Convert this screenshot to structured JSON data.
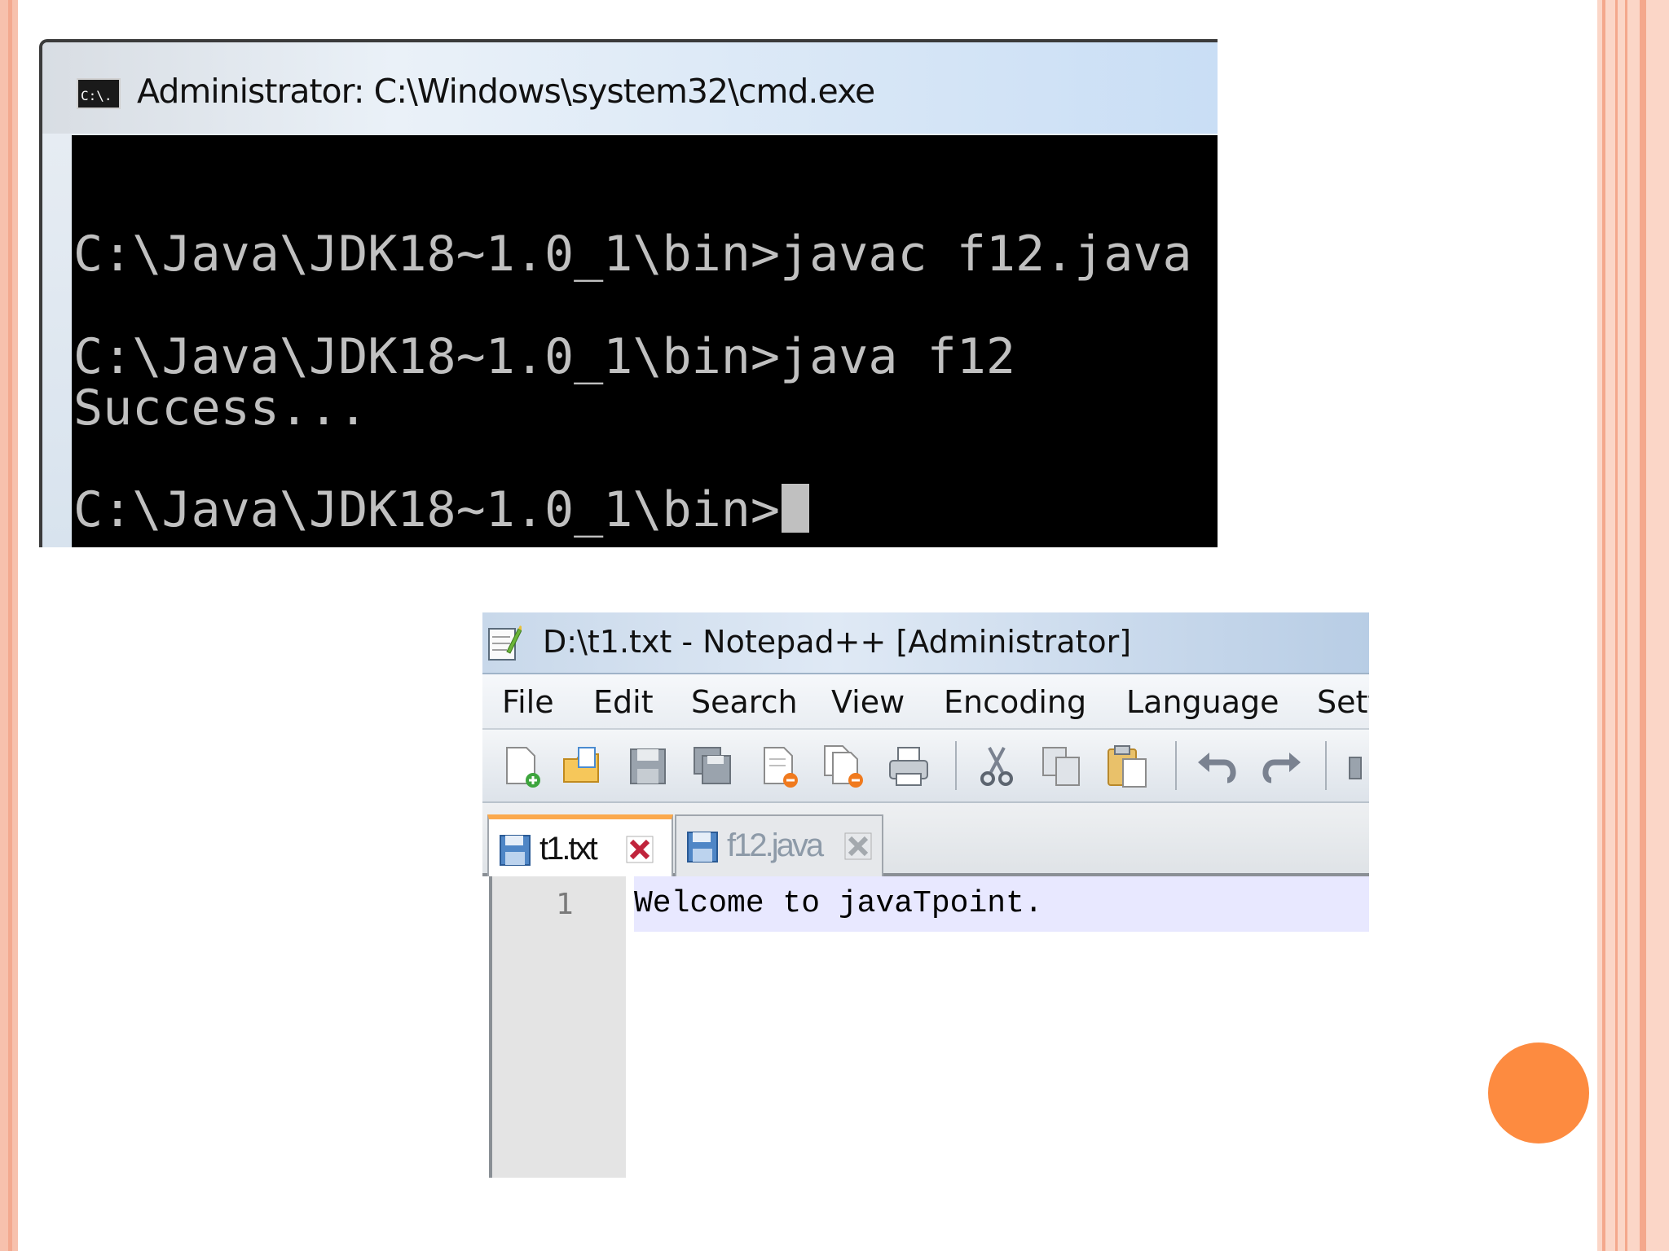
{
  "cmd": {
    "title": "Administrator: C:\\Windows\\system32\\cmd.exe",
    "icon_text": "C:\\.",
    "lines": [
      "C:\\Java\\JDK18~1.0_1\\bin>javac f12.java",
      "C:\\Java\\JDK18~1.0_1\\bin>java f12",
      "Success...",
      "C:\\Java\\JDK18~1.0_1\\bin>"
    ]
  },
  "notepad": {
    "title": "D:\\t1.txt - Notepad++ [Administrator]",
    "menu": [
      "File",
      "Edit",
      "Search",
      "View",
      "Encoding",
      "Language",
      "Sett"
    ],
    "toolbar_icons": [
      "new-file-icon",
      "open-file-icon",
      "save-icon",
      "save-all-icon",
      "close-icon",
      "close-all-icon",
      "print-icon",
      "cut-icon",
      "copy-icon",
      "paste-icon",
      "undo-icon",
      "redo-icon"
    ],
    "tabs": [
      {
        "label": "t1.txt",
        "active": true
      },
      {
        "label": "f12.java",
        "active": false
      }
    ],
    "editor": {
      "line_number": "1",
      "text": "Welcome to javaTpoint."
    }
  },
  "colors": {
    "slide_accent": "#fd8b40",
    "tab_active_top": "#fba94d",
    "console_bg": "#000000",
    "console_fg": "#c0c0c0"
  }
}
